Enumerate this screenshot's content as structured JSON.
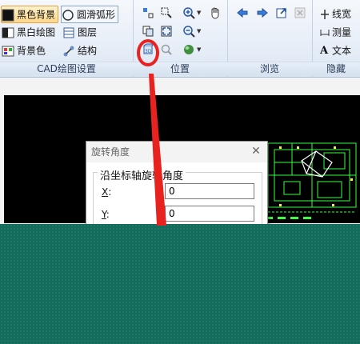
{
  "ribbon": {
    "cad_settings": {
      "label": "CAD绘图设置",
      "black_background": "黑色背景",
      "smooth_arc": "圆滑弧形",
      "black_white_drawing": "黑白绘图",
      "layers": "图层",
      "background_color": "背景色",
      "structure": "结构"
    },
    "position": {
      "label": "位置"
    },
    "browse": {
      "label": "浏览"
    },
    "hidden": {
      "label": "隐藏",
      "line_width": "线宽",
      "measure": "测量",
      "text": "文本"
    }
  },
  "dialog": {
    "title": "旋转角度",
    "close": "✕",
    "group_label": "沿坐标轴旋转角度",
    "x_label": "X",
    "x_value": "0",
    "y_label": "Y",
    "y_value": "0"
  },
  "colors": {
    "annotation": "#e8231f",
    "teal_overlay": "#136d5c",
    "drawing_bg": "#000000",
    "cad_lines": "#39ff3f"
  }
}
